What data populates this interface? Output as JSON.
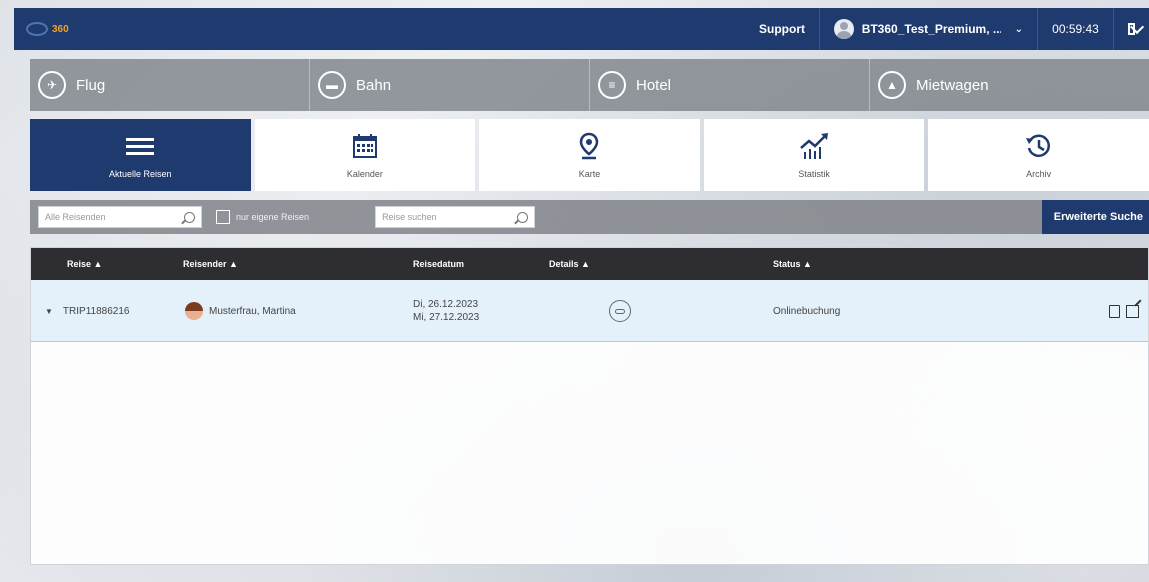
{
  "header": {
    "logo_text": "360",
    "support_label": "Support",
    "user_name": "BT360_Test_Premium, ...",
    "user_dropdown_chevron": "chevron-down-icon",
    "session_timer": "00:59:43",
    "mail_icon": "mail-icon"
  },
  "modes": [
    {
      "label": "Flug",
      "icon": "plane-icon"
    },
    {
      "label": "Bahn",
      "icon": "train-icon"
    },
    {
      "label": "Hotel",
      "icon": "hotel-icon"
    },
    {
      "label": "Mietwagen",
      "icon": "car-icon"
    }
  ],
  "tiles": [
    {
      "label": "Aktuelle Reisen",
      "icon": "menu-icon",
      "active": true
    },
    {
      "label": "Kalender",
      "icon": "calendar-icon",
      "active": false
    },
    {
      "label": "Karte",
      "icon": "map-pin-icon",
      "active": false
    },
    {
      "label": "Statistik",
      "icon": "chart-icon",
      "active": false
    },
    {
      "label": "Archiv",
      "icon": "history-icon",
      "active": false
    }
  ],
  "filters": {
    "traveler_placeholder": "Alle Reisenden",
    "own_trips_label": "nur eigene Reisen",
    "trip_search_placeholder": "Reise suchen",
    "advanced_search_label": "Erweiterte Suche"
  },
  "table": {
    "columns": [
      "Reise ▲",
      "Reisender ▲",
      "Reisedatum",
      "Details ▲",
      "Status ▲"
    ],
    "rows": [
      {
        "trip_id": "TRIP11886216",
        "traveler": "Musterfrau, Martina",
        "date_start": "Di, 26.12.2023",
        "date_end": "Mi, 27.12.2023",
        "status": "Onlinebuchung"
      }
    ]
  }
}
